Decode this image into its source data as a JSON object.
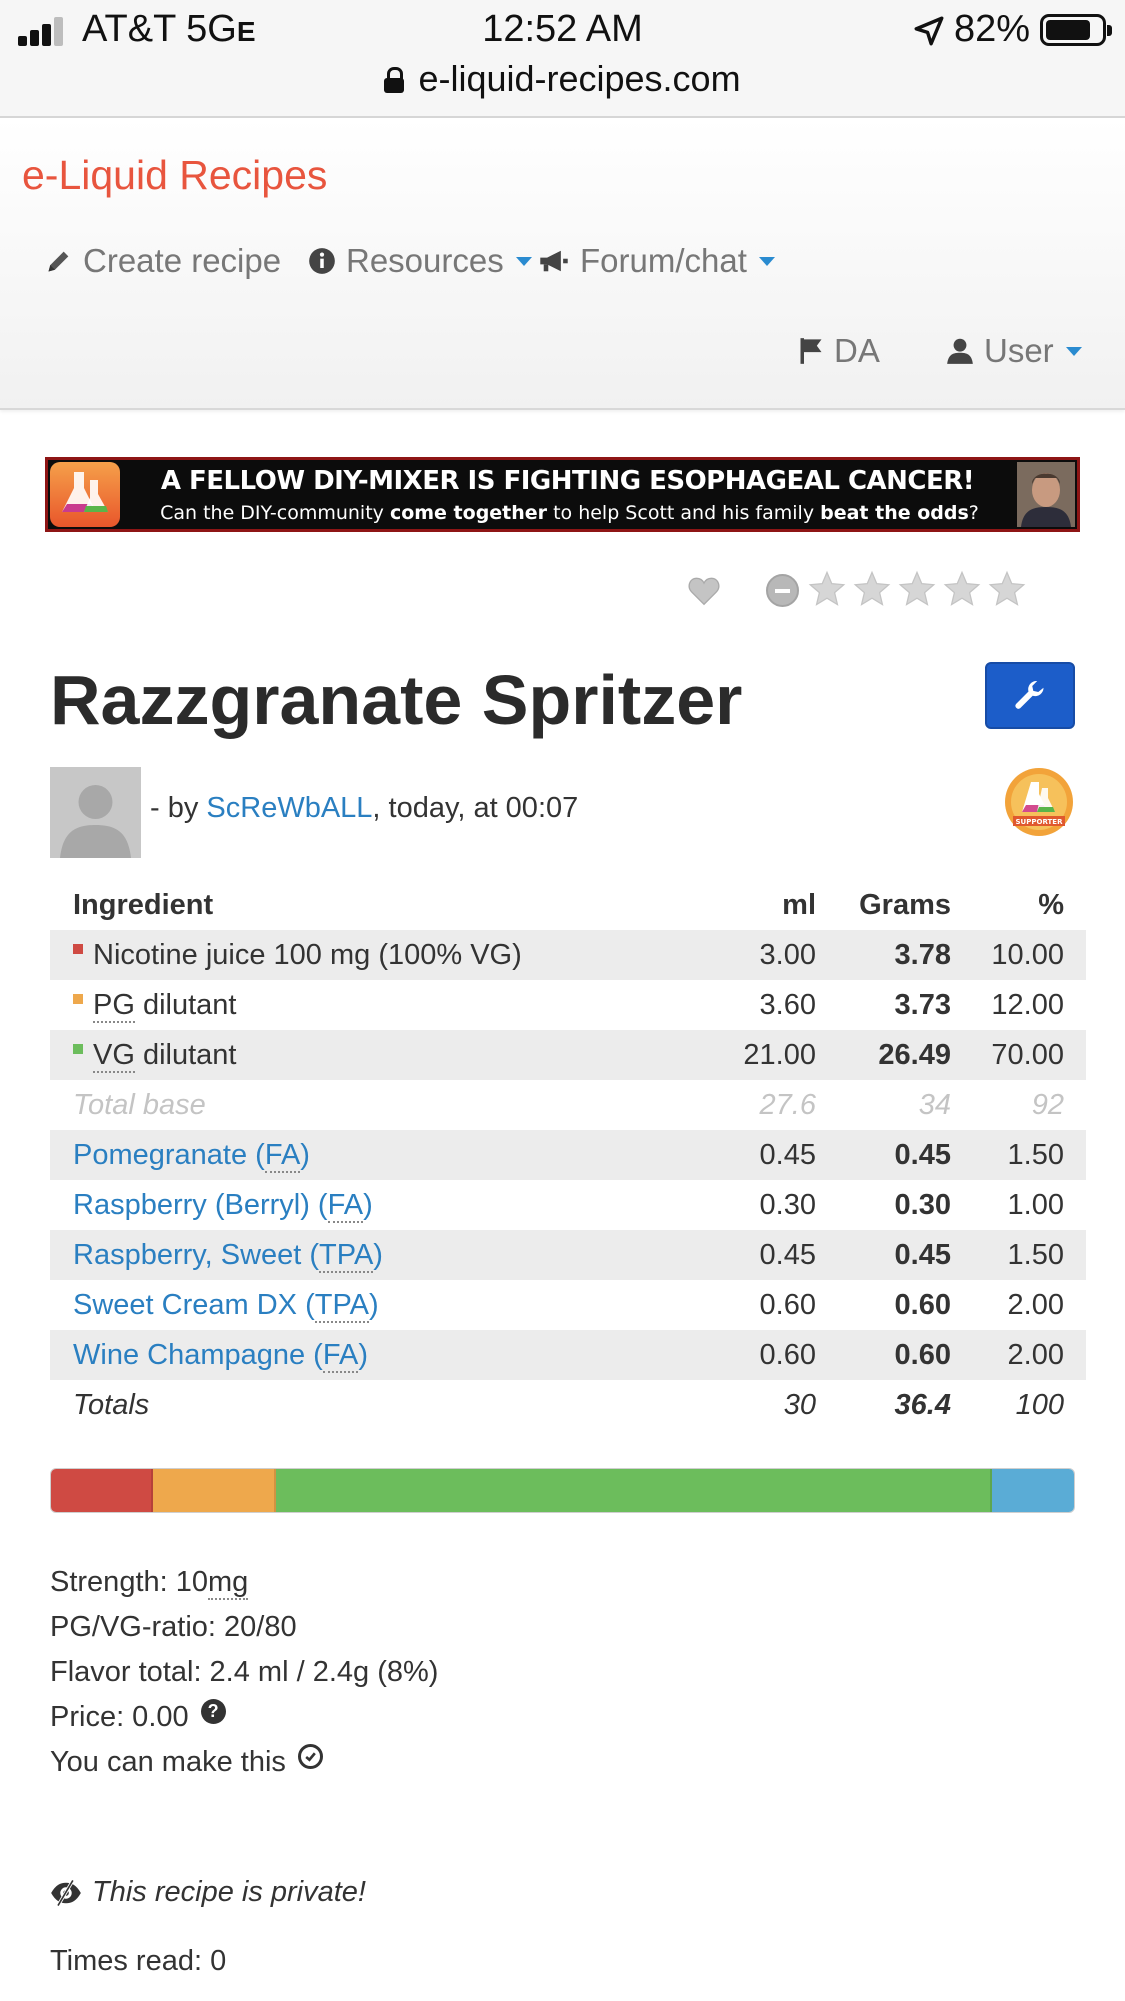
{
  "status": {
    "carrier": "AT&T",
    "network": "5G",
    "network_suffix": "E",
    "time": "12:52 AM",
    "battery_percent": "82%",
    "battery_level": 0.82,
    "signal_bars": 3,
    "url": "e-liquid-recipes.com"
  },
  "nav": {
    "brand": "e-Liquid Recipes",
    "create_recipe": "Create recipe",
    "resources": "Resources",
    "forum": "Forum/chat",
    "language": "DA",
    "user": "User",
    "accent_color": "#2a8bd0",
    "brand_color": "#e8553e"
  },
  "banner": {
    "headline": "A FELLOW DIY-MIXER IS FIGHTING ESOPHAGEAL CANCER!",
    "sub_1": "Can the DIY-community ",
    "sub_bold_1": "come together",
    "sub_2": " to help Scott and his family ",
    "sub_bold_2": "beat the odds",
    "sub_3": "?"
  },
  "rating": {
    "stars": 5,
    "filled": 0
  },
  "recipe": {
    "title": "Razzgranate Spritzer",
    "by_prefix": "- by ",
    "author": "ScReWbALL",
    "date": ", today, at 00:07",
    "badge": "SUPPORTER"
  },
  "table": {
    "headers": {
      "ingredient": "Ingredient",
      "ml": "ml",
      "grams": "Grams",
      "pct": "%"
    },
    "base": [
      {
        "pre": "Nicotine juice 100 mg (100% VG)",
        "abbr": "",
        "post": "",
        "ml": "3.00",
        "g": "3.78",
        "pct": "10.00",
        "color": "#cf4a43"
      },
      {
        "pre": "",
        "abbr": "PG",
        "post": " dilutant",
        "ml": "3.60",
        "g": "3.73",
        "pct": "12.00",
        "color": "#eea84c"
      },
      {
        "pre": "",
        "abbr": "VG",
        "post": " dilutant",
        "ml": "21.00",
        "g": "26.49",
        "pct": "70.00",
        "color": "#6cbd5c"
      }
    ],
    "total_base": {
      "label": "Total base",
      "ml": "27.6",
      "g": "34",
      "pct": "92"
    },
    "flavors": [
      {
        "name": "Pomegranate (",
        "abbr": "FA",
        "close": ")",
        "ml": "0.45",
        "g": "0.45",
        "pct": "1.50"
      },
      {
        "name": "Raspberry (Berryl) (",
        "abbr": "FA",
        "close": ")",
        "ml": "0.30",
        "g": "0.30",
        "pct": "1.00"
      },
      {
        "name": "Raspberry, Sweet (",
        "abbr": "TPA",
        "close": ")",
        "ml": "0.45",
        "g": "0.45",
        "pct": "1.50"
      },
      {
        "name": "Sweet Cream DX (",
        "abbr": "TPA",
        "close": ")",
        "ml": "0.60",
        "g": "0.60",
        "pct": "2.00"
      },
      {
        "name": "Wine Champagne (",
        "abbr": "FA",
        "close": ")",
        "ml": "0.60",
        "g": "0.60",
        "pct": "2.00"
      }
    ],
    "totals": {
      "label": "Totals",
      "ml": "30",
      "g": "36.4",
      "pct": "100"
    }
  },
  "mix_bar": [
    {
      "name": "nicotine",
      "percent": 10,
      "color": "#cf4a43"
    },
    {
      "name": "pg",
      "percent": 12,
      "color": "#eea84c"
    },
    {
      "name": "vg",
      "percent": 70,
      "color": "#6cbd5c"
    },
    {
      "name": "flavor",
      "percent": 8,
      "color": "#5aacd6"
    }
  ],
  "stats": {
    "strength_label": "Strength: 10 ",
    "strength_unit": "mg",
    "ratio": "PG/VG-ratio: 20/80",
    "flavor_total": "Flavor total: 2.4 ml / 2.4g (8%)",
    "price": "Price: 0.00",
    "can_make": "You can make this"
  },
  "private_note": "This recipe is private!",
  "times_read": "Times read: 0"
}
